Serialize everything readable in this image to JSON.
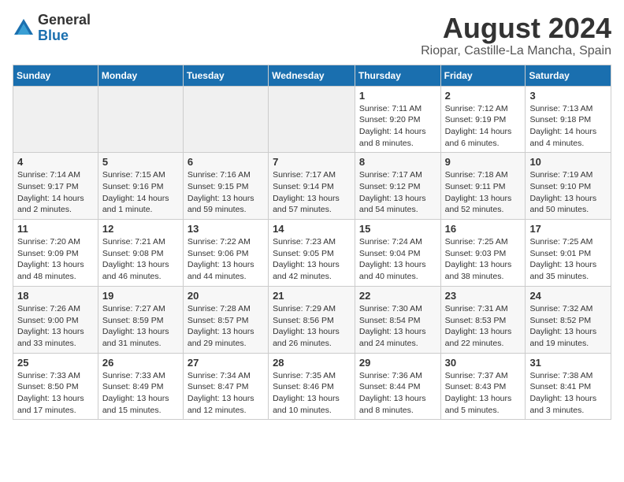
{
  "logo": {
    "general": "General",
    "blue": "Blue"
  },
  "title": {
    "month_year": "August 2024",
    "location": "Riopar, Castille-La Mancha, Spain"
  },
  "days_of_week": [
    "Sunday",
    "Monday",
    "Tuesday",
    "Wednesday",
    "Thursday",
    "Friday",
    "Saturday"
  ],
  "weeks": [
    [
      {
        "day": "",
        "detail": ""
      },
      {
        "day": "",
        "detail": ""
      },
      {
        "day": "",
        "detail": ""
      },
      {
        "day": "",
        "detail": ""
      },
      {
        "day": "1",
        "detail": "Sunrise: 7:11 AM\nSunset: 9:20 PM\nDaylight: 14 hours and 8 minutes."
      },
      {
        "day": "2",
        "detail": "Sunrise: 7:12 AM\nSunset: 9:19 PM\nDaylight: 14 hours and 6 minutes."
      },
      {
        "day": "3",
        "detail": "Sunrise: 7:13 AM\nSunset: 9:18 PM\nDaylight: 14 hours and 4 minutes."
      }
    ],
    [
      {
        "day": "4",
        "detail": "Sunrise: 7:14 AM\nSunset: 9:17 PM\nDaylight: 14 hours and 2 minutes."
      },
      {
        "day": "5",
        "detail": "Sunrise: 7:15 AM\nSunset: 9:16 PM\nDaylight: 14 hours and 1 minute."
      },
      {
        "day": "6",
        "detail": "Sunrise: 7:16 AM\nSunset: 9:15 PM\nDaylight: 13 hours and 59 minutes."
      },
      {
        "day": "7",
        "detail": "Sunrise: 7:17 AM\nSunset: 9:14 PM\nDaylight: 13 hours and 57 minutes."
      },
      {
        "day": "8",
        "detail": "Sunrise: 7:17 AM\nSunset: 9:12 PM\nDaylight: 13 hours and 54 minutes."
      },
      {
        "day": "9",
        "detail": "Sunrise: 7:18 AM\nSunset: 9:11 PM\nDaylight: 13 hours and 52 minutes."
      },
      {
        "day": "10",
        "detail": "Sunrise: 7:19 AM\nSunset: 9:10 PM\nDaylight: 13 hours and 50 minutes."
      }
    ],
    [
      {
        "day": "11",
        "detail": "Sunrise: 7:20 AM\nSunset: 9:09 PM\nDaylight: 13 hours and 48 minutes."
      },
      {
        "day": "12",
        "detail": "Sunrise: 7:21 AM\nSunset: 9:08 PM\nDaylight: 13 hours and 46 minutes."
      },
      {
        "day": "13",
        "detail": "Sunrise: 7:22 AM\nSunset: 9:06 PM\nDaylight: 13 hours and 44 minutes."
      },
      {
        "day": "14",
        "detail": "Sunrise: 7:23 AM\nSunset: 9:05 PM\nDaylight: 13 hours and 42 minutes."
      },
      {
        "day": "15",
        "detail": "Sunrise: 7:24 AM\nSunset: 9:04 PM\nDaylight: 13 hours and 40 minutes."
      },
      {
        "day": "16",
        "detail": "Sunrise: 7:25 AM\nSunset: 9:03 PM\nDaylight: 13 hours and 38 minutes."
      },
      {
        "day": "17",
        "detail": "Sunrise: 7:25 AM\nSunset: 9:01 PM\nDaylight: 13 hours and 35 minutes."
      }
    ],
    [
      {
        "day": "18",
        "detail": "Sunrise: 7:26 AM\nSunset: 9:00 PM\nDaylight: 13 hours and 33 minutes."
      },
      {
        "day": "19",
        "detail": "Sunrise: 7:27 AM\nSunset: 8:59 PM\nDaylight: 13 hours and 31 minutes."
      },
      {
        "day": "20",
        "detail": "Sunrise: 7:28 AM\nSunset: 8:57 PM\nDaylight: 13 hours and 29 minutes."
      },
      {
        "day": "21",
        "detail": "Sunrise: 7:29 AM\nSunset: 8:56 PM\nDaylight: 13 hours and 26 minutes."
      },
      {
        "day": "22",
        "detail": "Sunrise: 7:30 AM\nSunset: 8:54 PM\nDaylight: 13 hours and 24 minutes."
      },
      {
        "day": "23",
        "detail": "Sunrise: 7:31 AM\nSunset: 8:53 PM\nDaylight: 13 hours and 22 minutes."
      },
      {
        "day": "24",
        "detail": "Sunrise: 7:32 AM\nSunset: 8:52 PM\nDaylight: 13 hours and 19 minutes."
      }
    ],
    [
      {
        "day": "25",
        "detail": "Sunrise: 7:33 AM\nSunset: 8:50 PM\nDaylight: 13 hours and 17 minutes."
      },
      {
        "day": "26",
        "detail": "Sunrise: 7:33 AM\nSunset: 8:49 PM\nDaylight: 13 hours and 15 minutes."
      },
      {
        "day": "27",
        "detail": "Sunrise: 7:34 AM\nSunset: 8:47 PM\nDaylight: 13 hours and 12 minutes."
      },
      {
        "day": "28",
        "detail": "Sunrise: 7:35 AM\nSunset: 8:46 PM\nDaylight: 13 hours and 10 minutes."
      },
      {
        "day": "29",
        "detail": "Sunrise: 7:36 AM\nSunset: 8:44 PM\nDaylight: 13 hours and 8 minutes."
      },
      {
        "day": "30",
        "detail": "Sunrise: 7:37 AM\nSunset: 8:43 PM\nDaylight: 13 hours and 5 minutes."
      },
      {
        "day": "31",
        "detail": "Sunrise: 7:38 AM\nSunset: 8:41 PM\nDaylight: 13 hours and 3 minutes."
      }
    ]
  ]
}
